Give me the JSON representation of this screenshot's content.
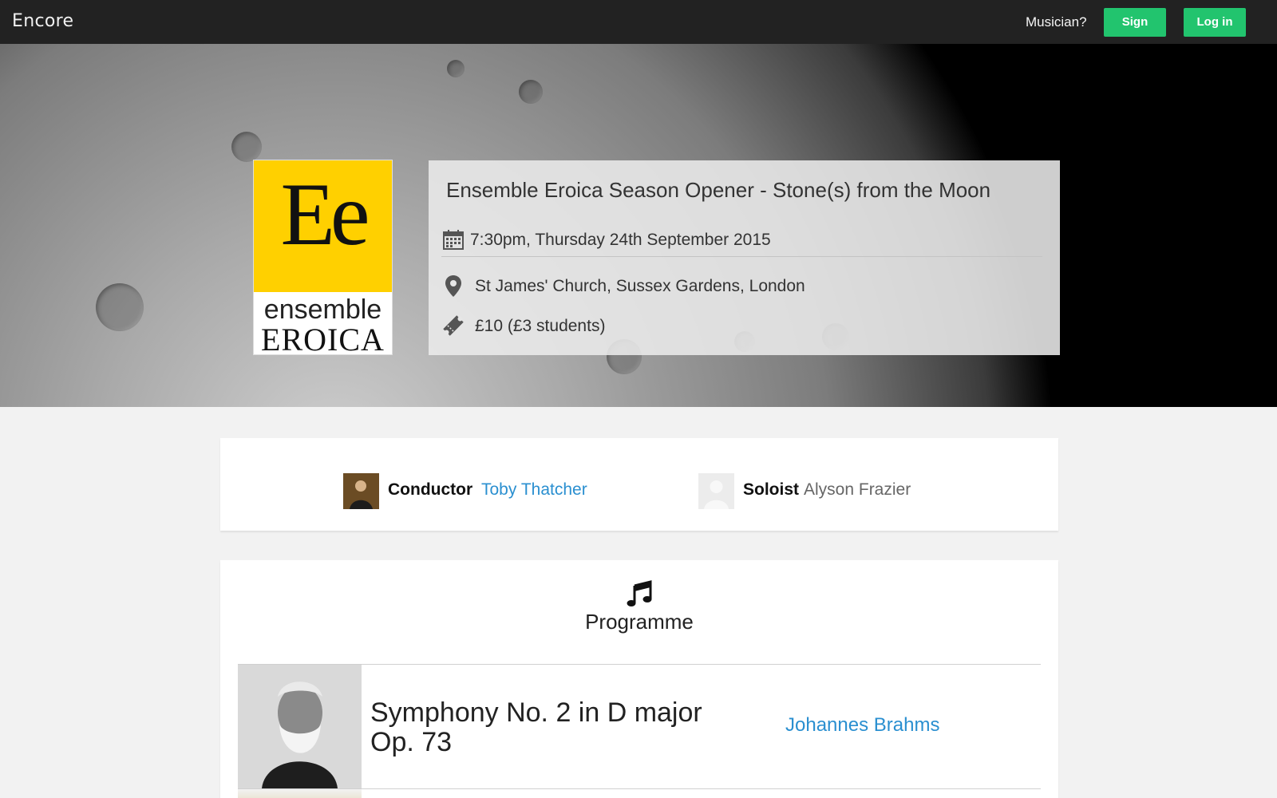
{
  "navbar": {
    "brand": "Encore",
    "musician_text": "Musician?",
    "signup_label": "Sign up",
    "login_label": "Log in",
    "accent_color": "#22c46e"
  },
  "event": {
    "logo_initials": "Ee",
    "logo_line1": "ensemble",
    "logo_line2": "EROICA",
    "title": "Ensemble Eroica Season Opener - Stone(s) from the Moon",
    "datetime": "7:30pm, Thursday 24th September 2015",
    "venue": "St James' Church, Sussex Gardens, London",
    "price": "£10 (£3 students)",
    "icons": [
      "calendar-icon",
      "map-marker-icon",
      "ticket-icon"
    ]
  },
  "people": [
    {
      "role": "Conductor",
      "name": "Toby Thatcher"
    },
    {
      "role": "Soloist",
      "name": "Alyson Frazier"
    }
  ],
  "programme": {
    "heading": "Programme",
    "works": [
      {
        "title": "Symphony No. 2 in D major Op. 73",
        "composer": "Johannes Brahms"
      }
    ]
  },
  "colors": {
    "link_blue": "#2a8fd0",
    "logo_yellow": "#ffd000",
    "navbar_bg": "#222222"
  }
}
